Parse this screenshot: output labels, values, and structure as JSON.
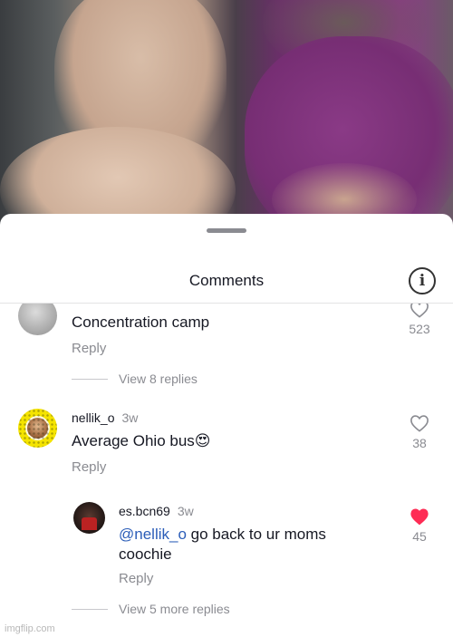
{
  "sheet": {
    "title": "Comments"
  },
  "comments": [
    {
      "username": "",
      "text": "Concentration camp",
      "reply_label": "Reply",
      "likes": "523",
      "liked": false,
      "view_replies": "View 8 replies"
    },
    {
      "username": "nellik_o",
      "time": "3w",
      "text": "Average Ohio bus😍",
      "reply_label": "Reply",
      "likes": "38",
      "liked": false,
      "replies": [
        {
          "username": "es.bcn69",
          "time": "3w",
          "mention": "@nellik_o",
          "text_after_mention": " go back to ur moms",
          "text_line2": "coochie",
          "reply_label": "Reply",
          "likes": "45",
          "liked": true
        }
      ],
      "view_replies": "View 5 more replies"
    }
  ],
  "colors": {
    "liked_heart": "#fe2c55",
    "mention": "#2b5db8",
    "muted": "#8a8b91"
  },
  "icons": {
    "info": "info-icon",
    "heart": "heart-icon"
  },
  "watermark": "imgflip.com"
}
